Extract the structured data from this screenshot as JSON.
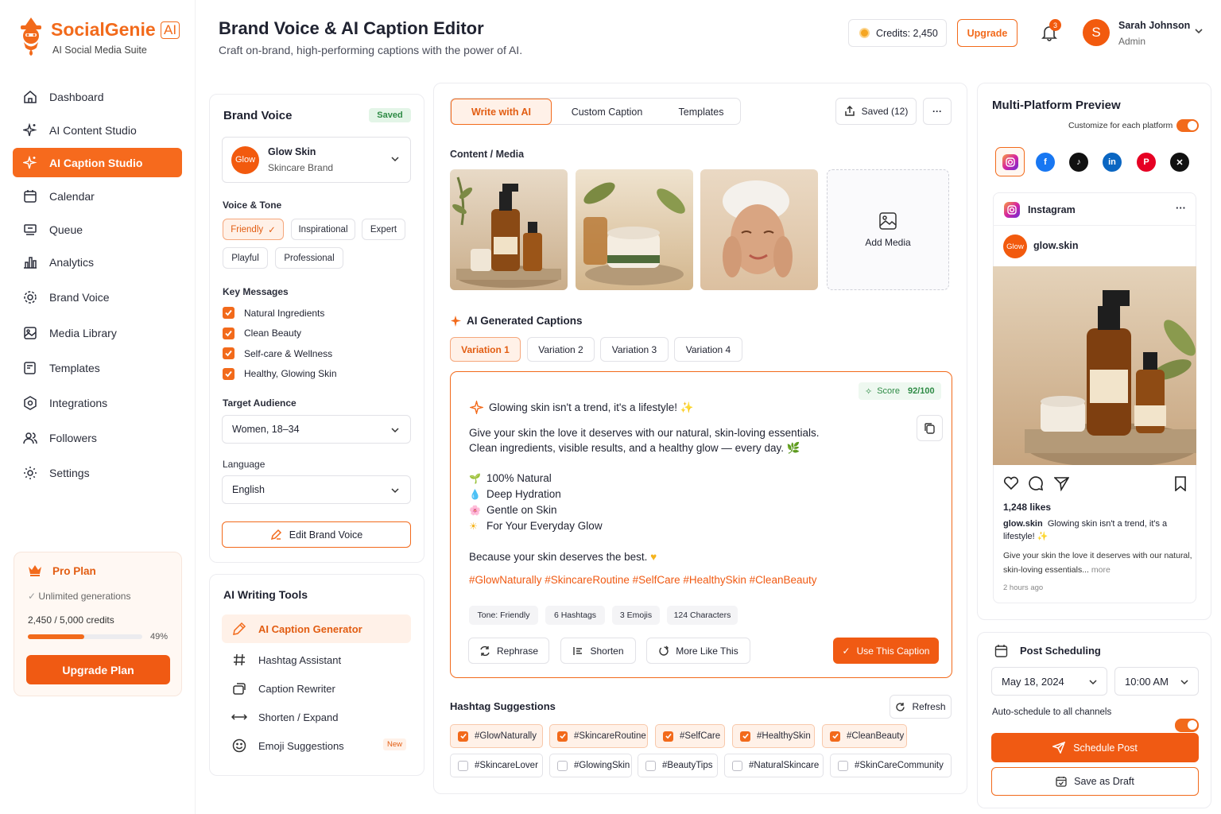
{
  "brand": {
    "name": "SocialGenie",
    "badge": "AI",
    "tagline": "AI Social Media Suite"
  },
  "nav": [
    {
      "label": "Dashboard",
      "icon": "home-icon"
    },
    {
      "label": "AI Content Studio",
      "icon": "sparkle-icon"
    },
    {
      "label": "AI Caption Studio",
      "icon": "sparkle-icon",
      "active": true
    },
    {
      "label": "Calendar",
      "icon": "calendar-icon"
    },
    {
      "label": "Queue",
      "icon": "queue-icon"
    },
    {
      "label": "Analytics",
      "icon": "bar-chart-icon"
    },
    {
      "label": "Brand Voice",
      "icon": "gear-icon"
    },
    {
      "label": "Media Library",
      "icon": "image-icon"
    },
    {
      "label": "Templates",
      "icon": "template-icon"
    },
    {
      "label": "Integrations",
      "icon": "integrations-icon"
    },
    {
      "label": "Followers",
      "icon": "users-icon"
    },
    {
      "label": "Settings",
      "icon": "settings-icon"
    }
  ],
  "plan": {
    "name": "Pro Plan",
    "feature": "Unlimited generations",
    "credits": "2,450 / 5,000 credits",
    "percent_label": "49%",
    "percent": 0.49,
    "button": "Upgrade Plan"
  },
  "header": {
    "title": "Brand Voice & AI Caption Editor",
    "subtitle": "Craft on-brand, high-performing captions with the power of AI.",
    "credits": "Credits: 2,450",
    "upgrade": "Upgrade",
    "notifications": "3",
    "user_initial": "S",
    "user_name": "Sarah Johnson",
    "user_role": "Admin"
  },
  "brand_voice": {
    "title": "Brand Voice",
    "status": "Saved",
    "brand_avatar": "Glow",
    "brand_name": "Glow Skin",
    "brand_type": "Skincare Brand",
    "tone_label": "Voice & Tone",
    "tones": [
      "Friendly",
      "Inspirational",
      "Expert",
      "Playful",
      "Professional"
    ],
    "messages_label": "Key Messages",
    "messages": [
      "Natural Ingredients",
      "Clean Beauty",
      "Self-care & Wellness",
      "Healthy, Glowing Skin"
    ],
    "audience_label": "Target Audience",
    "audience": "Women, 18–34",
    "language_label": "Language",
    "language": "English",
    "edit_button": "Edit Brand Voice"
  },
  "tools": {
    "title": "AI Writing Tools",
    "items": [
      {
        "label": "AI Caption Generator",
        "icon": "pen-icon"
      },
      {
        "label": "Hashtag Assistant",
        "icon": "hashtag-icon"
      },
      {
        "label": "Caption Rewriter",
        "icon": "rewrite-icon"
      },
      {
        "label": "Shorten / Expand",
        "icon": "arrows-icon"
      },
      {
        "label": "Emoji Suggestions",
        "icon": "smiley-icon",
        "badge": "New"
      }
    ]
  },
  "editor": {
    "tabs": [
      "Write with AI",
      "Custom Caption",
      "Templates"
    ],
    "saved": "Saved (12)",
    "media_label": "Content / Media",
    "add_media": "Add Media",
    "captions_label": "AI Generated Captions",
    "variations": [
      "Variation 1",
      "Variation 2",
      "Variation 3",
      "Variation 4"
    ],
    "score_label": "Score",
    "score": "92/100",
    "caption_title": "Glowing skin isn't a trend, it's a lifestyle!",
    "caption_line1": "Give your skin the love it deserves with our natural, skin-loving essentials.",
    "caption_line2": "Clean ingredients, visible results, and a healthy glow — every day.",
    "bullets": [
      "100% Natural",
      "Deep Hydration",
      "Gentle on Skin",
      "For Your Everyday Glow"
    ],
    "closing": "Because your skin deserves the best.",
    "hashtags_line": "#GlowNaturally #SkincareRoutine #SelfCare #HealthySkin #CleanBeauty",
    "meta": [
      "Tone: Friendly",
      "6 Hashtags",
      "3 Emojis",
      "124 Characters"
    ],
    "actions": [
      "Rephrase",
      "Shorten",
      "More Like This"
    ],
    "use_button": "Use This Caption",
    "hashtag_label": "Hashtag Suggestions",
    "refresh": "Refresh",
    "hashtags_selected": [
      "#GlowNaturally",
      "#SkincareRoutine",
      "#SelfCare",
      "#HealthySkin",
      "#CleanBeauty"
    ],
    "hashtags_more": [
      "#SkincareLover",
      "#GlowingSkin",
      "#BeautyTips",
      "#NaturalSkincare",
      "#SkinCareCommunity"
    ]
  },
  "preview": {
    "title": "Multi-Platform Preview",
    "customize": "Customize for each platform",
    "platform": "Instagram",
    "account": "glow.skin",
    "avatar": "Glow",
    "likes": "1,248 likes",
    "caption_user": "glow.skin",
    "caption_text": "Glowing skin isn't a trend, it's a lifestyle!",
    "caption_more": "Give your skin the love it deserves with our natural, skin-loving essentials...",
    "more": "more",
    "time": "2 hours ago"
  },
  "scheduling": {
    "title": "Post Scheduling",
    "date": "May 18, 2024",
    "time": "10:00 AM",
    "auto_label": "Auto-schedule to all channels",
    "schedule_button": "Schedule Post",
    "draft_button": "Save as Draft"
  },
  "colors": {
    "accent": "#f26a1b",
    "accent_soft": "#fff1e8"
  }
}
